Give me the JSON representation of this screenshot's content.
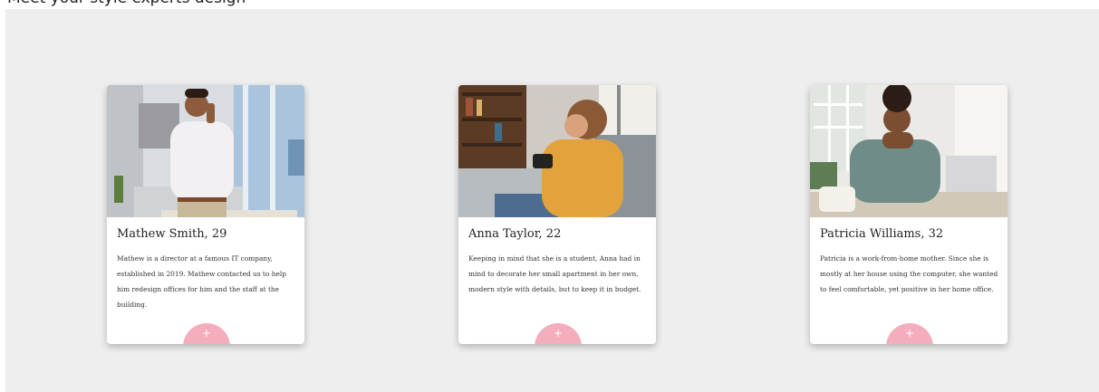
{
  "page": {
    "top_text": "Meet your style experts design",
    "accent": "#f4adbd"
  },
  "cards": [
    {
      "name": "Mathew Smith, 29",
      "description": "Mathew is a director at a famous IT company, established in 2019. Mathew contacted us to help him redesign offices for him and the staff at the building.",
      "button_icon": "+",
      "photo_icon": "man-on-phone-photo"
    },
    {
      "name": "Anna Taylor, 22",
      "description": "Keeping in mind that she is a student, Anna had in mind to decorate her small apartment in her own, modern style with details, but to keep it in budget.",
      "button_icon": "+",
      "photo_icon": "woman-with-phone-photo"
    },
    {
      "name": "Patricia Williams, 32",
      "description": "Patricia is a work-from-home mother. Since she is mostly at her house using the computer, she wanted to feel comfortable, yet positive in her home office.",
      "button_icon": "+",
      "photo_icon": "woman-at-laptop-photo"
    }
  ]
}
